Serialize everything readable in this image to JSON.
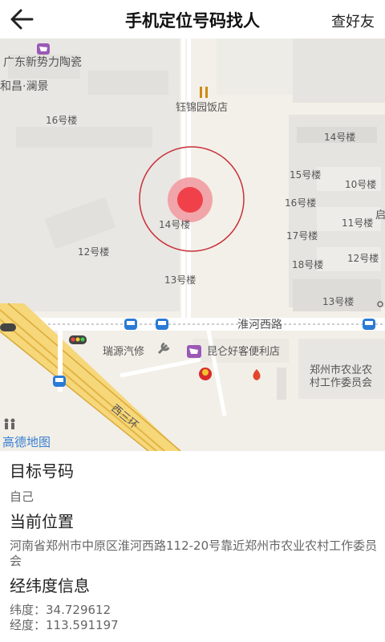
{
  "header": {
    "title": "手机定位号码找人",
    "right_action": "查好友"
  },
  "map": {
    "labels": {
      "poi_tile": "广东新势力陶瓷",
      "poi_hechang": "和昌·澜景",
      "b16": "16号楼",
      "poi_restaurant": "钰锦园饭店",
      "b14": "14号楼",
      "b15": "15号楼",
      "b10": "10号楼",
      "b16r": "16号楼",
      "b11": "11号楼",
      "b17": "17号楼",
      "b12r": "12号楼",
      "b18": "18号楼",
      "b14c": "14号楼",
      "b12": "12号楼",
      "b13": "13号楼",
      "b13r": "13号楼",
      "road_huaihe": "淮河西路",
      "poi_car": "瑞源汽修",
      "poi_store": "昆仑好客便利店",
      "poi_committee_1": "郑州市农业农",
      "poi_committee_2": "村工作委员会",
      "road_xisanhuan": "西三环",
      "edge_qi": "启",
      "logo": "高德地图"
    }
  },
  "info": {
    "target_heading": "目标号码",
    "target_value": "自己",
    "location_heading": "当前位置",
    "location_value": "河南省郑州市中原区淮河西路112-20号靠近郑州市农业农村工作委员会",
    "coords_heading": "经纬度信息",
    "latitude_label": "纬度：",
    "latitude_value": "34.729612",
    "longitude_label": "经度：",
    "longitude_value": "113.591197"
  }
}
